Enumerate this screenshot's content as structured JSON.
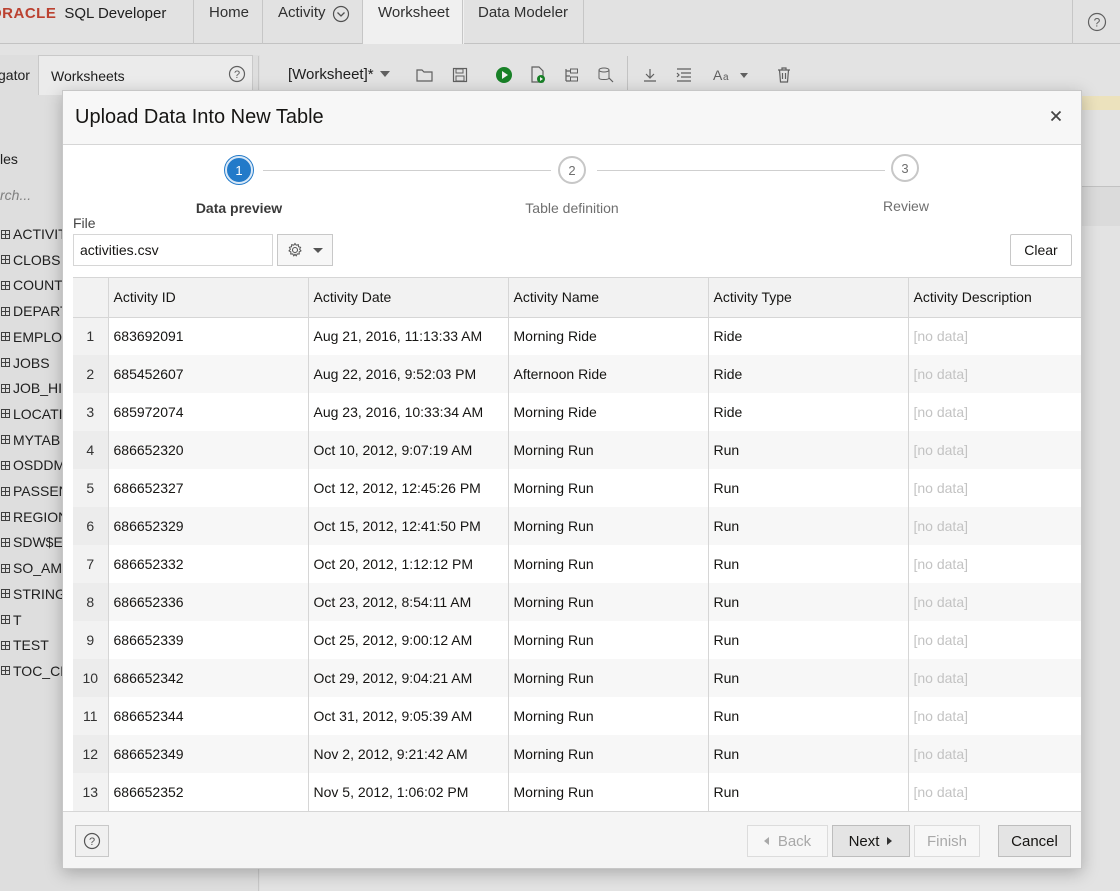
{
  "app": {
    "brand": "ORACLE",
    "product": "SQL Developer",
    "nav_tabs": [
      "Home",
      "Activity",
      "Worksheet",
      "Data Modeler"
    ],
    "active_tab": "Worksheet"
  },
  "left_panel": {
    "tab_partial": "gator",
    "tab_worksheets": "Worksheets",
    "section_label": "les",
    "search_placeholder": "rch...",
    "tables": [
      "ACTIVIT",
      "CLOBS",
      "COUNT",
      "DEPART",
      "EMPLO",
      "JOBS",
      "JOB_HI",
      "LOCATI",
      "MYTAB",
      "OSDDM",
      "PASSEN",
      "REGION",
      "SDW$E",
      "SO_AM",
      "STRING",
      "T",
      "TEST",
      "TOC_CF"
    ]
  },
  "worksheet": {
    "tab_label": "[Worksheet]*"
  },
  "dialog": {
    "title": "Upload Data Into New Table",
    "steps": [
      {
        "number": "1",
        "label": "Data preview",
        "active": true
      },
      {
        "number": "2",
        "label": "Table definition",
        "active": false
      },
      {
        "number": "3",
        "label": "Review",
        "active": false
      }
    ],
    "file": {
      "label": "File",
      "value": "activities.csv"
    },
    "clear_label": "Clear",
    "columns": [
      "Activity ID",
      "Activity Date",
      "Activity Name",
      "Activity Type",
      "Activity Description"
    ],
    "rows": [
      [
        "1",
        "683692091",
        "Aug 21, 2016, 11:13:33 AM",
        "Morning Ride",
        "Ride",
        "[no data]"
      ],
      [
        "2",
        "685452607",
        "Aug 22, 2016, 9:52:03 PM",
        "Afternoon Ride",
        "Ride",
        "[no data]"
      ],
      [
        "3",
        "685972074",
        "Aug 23, 2016, 10:33:34 AM",
        "Morning Ride",
        "Ride",
        "[no data]"
      ],
      [
        "4",
        "686652320",
        "Oct 10, 2012, 9:07:19 AM",
        "Morning Run",
        "Run",
        "[no data]"
      ],
      [
        "5",
        "686652327",
        "Oct 12, 2012, 12:45:26 PM",
        "Morning Run",
        "Run",
        "[no data]"
      ],
      [
        "6",
        "686652329",
        "Oct 15, 2012, 12:41:50 PM",
        "Morning Run",
        "Run",
        "[no data]"
      ],
      [
        "7",
        "686652332",
        "Oct 20, 2012, 1:12:12 PM",
        "Morning Run",
        "Run",
        "[no data]"
      ],
      [
        "8",
        "686652336",
        "Oct 23, 2012, 8:54:11 AM",
        "Morning Run",
        "Run",
        "[no data]"
      ],
      [
        "9",
        "686652339",
        "Oct 25, 2012, 9:00:12 AM",
        "Morning Run",
        "Run",
        "[no data]"
      ],
      [
        "10",
        "686652342",
        "Oct 29, 2012, 9:04:21 AM",
        "Morning Run",
        "Run",
        "[no data]"
      ],
      [
        "11",
        "686652344",
        "Oct 31, 2012, 9:05:39 AM",
        "Morning Run",
        "Run",
        "[no data]"
      ],
      [
        "12",
        "686652349",
        "Nov 2, 2012, 9:21:42 AM",
        "Morning Run",
        "Run",
        "[no data]"
      ],
      [
        "13",
        "686652352",
        "Nov 5, 2012, 1:06:02 PM",
        "Morning Run",
        "Run",
        "[no data]"
      ]
    ],
    "footer": {
      "back_label": "Back",
      "next_label": "Next",
      "finish_label": "Finish",
      "cancel_label": "Cancel"
    }
  },
  "colors": {
    "oracle_red": "#c74634",
    "step_active": "#227ac9",
    "run_green": "#1a8a2a"
  }
}
